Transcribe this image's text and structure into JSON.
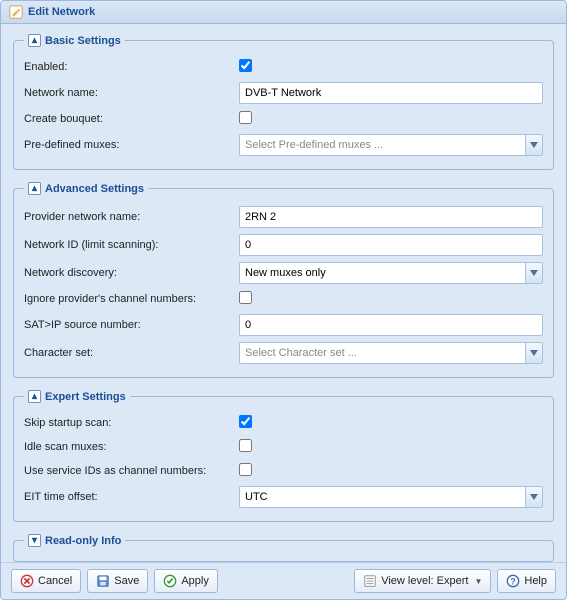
{
  "window": {
    "title": "Edit Network"
  },
  "sections": {
    "basic": {
      "legend": "Basic Settings",
      "enabled_label": "Enabled:",
      "enabled_checked": true,
      "network_name_label": "Network name:",
      "network_name_value": "DVB-T Network",
      "create_bouquet_label": "Create bouquet:",
      "create_bouquet_checked": false,
      "predefined_muxes_label": "Pre-defined muxes:",
      "predefined_muxes_value": "",
      "predefined_muxes_placeholder": "Select Pre-defined muxes ..."
    },
    "advanced": {
      "legend": "Advanced Settings",
      "provider_name_label": "Provider network name:",
      "provider_name_value": "2RN 2",
      "network_id_label": "Network ID (limit scanning):",
      "network_id_value": "0",
      "discovery_label": "Network discovery:",
      "discovery_value": "New muxes only",
      "ignore_numbers_label": "Ignore provider's channel numbers:",
      "ignore_numbers_checked": false,
      "satip_label": "SAT>IP source number:",
      "satip_value": "0",
      "charset_label": "Character set:",
      "charset_value": "",
      "charset_placeholder": "Select Character set ..."
    },
    "expert": {
      "legend": "Expert Settings",
      "skip_scan_label": "Skip startup scan:",
      "skip_scan_checked": true,
      "idle_scan_label": "Idle scan muxes:",
      "idle_scan_checked": false,
      "use_service_ids_label": "Use service IDs as channel numbers:",
      "use_service_ids_checked": false,
      "eit_offset_label": "EIT time offset:",
      "eit_offset_value": "UTC"
    },
    "readonly": {
      "legend": "Read-only Info"
    }
  },
  "buttons": {
    "cancel": "Cancel",
    "save": "Save",
    "apply": "Apply",
    "view_level": "View level: Expert",
    "help": "Help"
  }
}
